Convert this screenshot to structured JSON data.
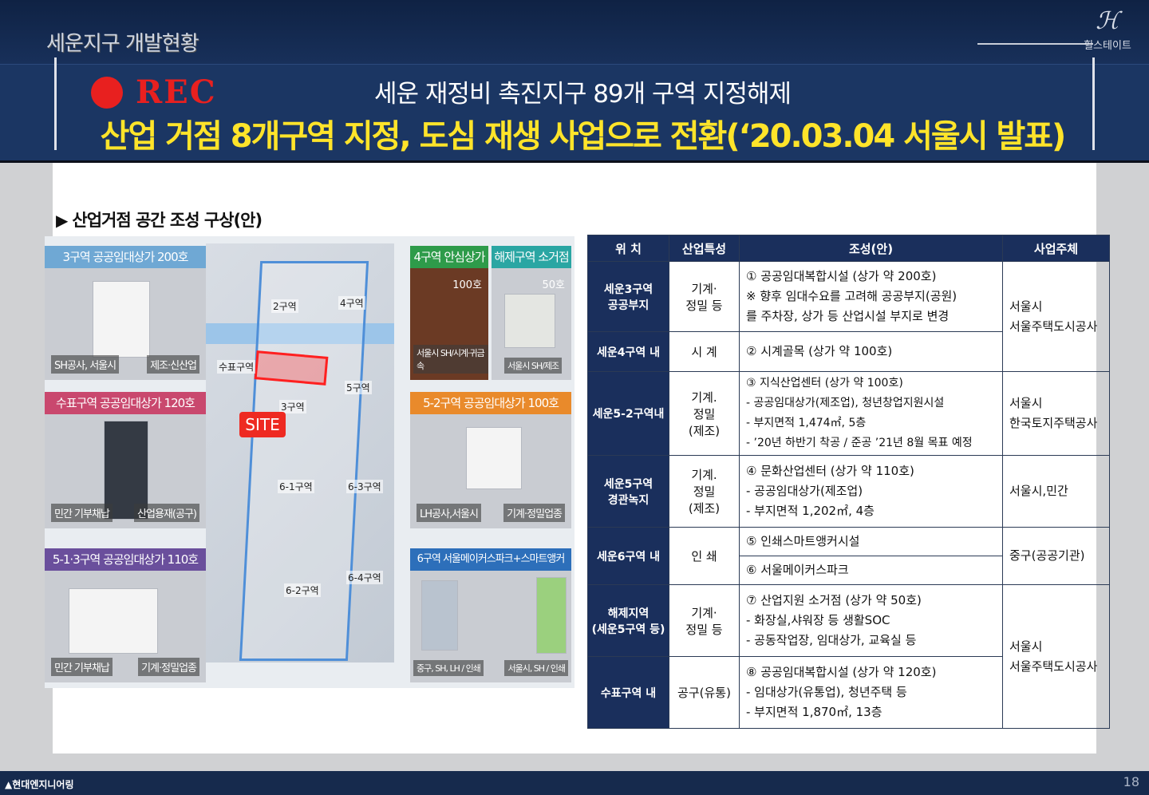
{
  "header": {
    "title": "세운지구 개발현황",
    "logo_text": "힐스테이트",
    "rec_label": "REC",
    "headline_1": "세운 재정비 촉진지구 89개 구역 지정해제",
    "headline_2": "산업 거점 8개구역 지정, 도심 재생 사업으로 전환(‘20.03.04 서울시 발표)"
  },
  "section": {
    "title": "산업거점 공간 조성 구상(안)"
  },
  "map": {
    "labels": [
      "2구역",
      "4구역",
      "수표구역",
      "3구역",
      "5구역",
      "6-1구역",
      "6-3구역",
      "6-2구역",
      "6-4구역"
    ],
    "site_label": "SITE"
  },
  "tiles": [
    {
      "header": "3구역 공공임대상가 200호",
      "tags": [
        "SH공사, 서울시",
        "제조·신산업"
      ],
      "header_color": "#6fa8d4"
    },
    {
      "header": "4구역 안심상가",
      "tags": [
        "서울시 SH/시계·귀금속"
      ],
      "note": "100호",
      "header_color": "#2e9b4a"
    },
    {
      "header": "해제구역 소거점",
      "tags": [
        "서울시 SH/제조"
      ],
      "note": "50호",
      "header_color": "#2aa6a3"
    },
    {
      "header": "수표구역 공공임대상가 120호",
      "tags": [
        "민간 기부채납",
        "산업용재(공구)"
      ],
      "header_color": "#c9486e"
    },
    {
      "header": "5-2구역 공공임대상가 100호",
      "tags": [
        "LH공사,서울시",
        "기계·정밀업종"
      ],
      "header_color": "#e98a2b"
    },
    {
      "header": "5-1·3구역 공공임대상가 110호",
      "tags": [
        "민간 기부채납",
        "기계·정밀업종"
      ],
      "header_color": "#6a4f9c"
    },
    {
      "header": "6구역 서울메이커스파크+스마트앵커",
      "tags": [
        "중구, SH, LH / 인쇄",
        "서울시, SH / 인쇄"
      ],
      "header_color": "#2d6fba"
    }
  ],
  "table": {
    "headers": [
      "위 치",
      "산업특성",
      "조성(안)",
      "사업주체"
    ],
    "rows": [
      {
        "location": "세운3구역\n공공부지",
        "industry": "기계·\n정밀 등",
        "plan": "① 공공임대복합시설 (상가 약 200호)\n※ 향후 임대수요를 고려해 공공부지(공원)\n   를 주차장, 상가 등 산업시설 부지로 변경",
        "org": "서울시\n서울주택도시공사"
      },
      {
        "location": "세운4구역 내",
        "industry": "시 계",
        "plan": "② 시계골목 (상가 약 100호)"
      },
      {
        "location": "세운5-2구역내",
        "industry": "기계.\n정밀\n(제조)",
        "plan": "③ 지식산업센터 (상가 약 100호)\n- 공공임대상가(제조업), 청년창업지원시설\n- 부지면적 1,474㎡, 5층\n- ’20년 하반기 착공 / 준공 ’21년 8월 목표 예정",
        "org": "서울시\n한국토지주택공사"
      },
      {
        "location": "세운5구역\n경관녹지",
        "industry": "기계.\n정밀\n(제조)",
        "plan": "④ 문화산업센터 (상가 약 110호)\n- 공공임대상가(제조업)\n- 부지면적 1,202㎡, 4층",
        "org": "서울시,민간"
      },
      {
        "location": "세운6구역 내",
        "industry": "인 쇄",
        "plan_a": "⑤ 인쇄스마트앵커시설",
        "plan_b": "⑥ 서울메이커스파크",
        "org": "중구(공공기관)"
      },
      {
        "location": "해제지역\n(세운5구역 등)",
        "industry": "기계·\n정밀 등",
        "plan": "⑦ 산업지원 소거점 (상가 약 50호)\n- 화장실,샤워장 등 생활SOC\n- 공동작업장, 임대상가, 교육실 등",
        "org": "서울시\n서울주택도시공사"
      },
      {
        "location": "수표구역 내",
        "industry": "공구(유통)",
        "plan": "⑧ 공공임대복합시설 (상가 약 120호)\n- 임대상가(유통업), 청년주택 등\n- 부지면적 1,870㎡, 13층"
      }
    ]
  },
  "footer": {
    "company": "현대엔지니어링",
    "page_number": "18"
  }
}
